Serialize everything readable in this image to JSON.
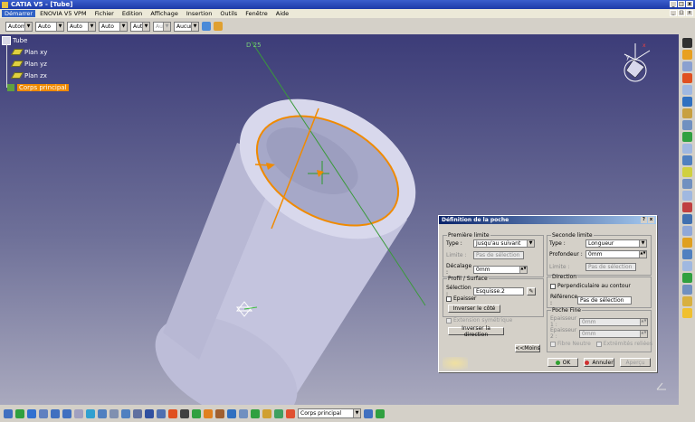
{
  "window": {
    "title": "CATIA V5 - [Tube]",
    "controls": [
      "_",
      "□",
      "x"
    ]
  },
  "menubar": {
    "items": [
      "Démarrer",
      "ENOVIA V5 VPM",
      "Fichier",
      "Edition",
      "Affichage",
      "Insertion",
      "Outils",
      "Fenêtre",
      "Aide"
    ]
  },
  "toolbar": {
    "combos": [
      "Automa",
      "Auto",
      "Auto",
      "Auto",
      "Aut",
      "Aut",
      "Aucun"
    ]
  },
  "tree": {
    "root": "Tube",
    "children": [
      "Plan xy",
      "Plan yz",
      "Plan zx",
      "Corps principal"
    ]
  },
  "viewport": {
    "axis_label": "D 25"
  },
  "dialog": {
    "title": "Définition de la poche",
    "first_limit": {
      "legend": "Première limite",
      "type_label": "Type :",
      "type_value": "Jusqu'au suivant",
      "limit_label": "Limite :",
      "limit_value": "Pas de sélection",
      "offset_label": "Décalage :",
      "offset_value": "0mm"
    },
    "profile": {
      "legend": "Profil / Surface",
      "selection_label": "Sélection :",
      "selection_value": "Esquisse.2",
      "thick_label": "Epaisser",
      "invert_side": "Inverser le côté"
    },
    "symmetric_label": "Extension symétrique",
    "invert_direction": "Inverser la direction",
    "second_limit": {
      "legend": "Seconde limite",
      "type_label": "Type :",
      "type_value": "Longueur",
      "depth_label": "Profondeur :",
      "depth_value": "0mm",
      "limit_label": "Limite :",
      "limit_value": "Pas de sélection"
    },
    "direction": {
      "legend": "Direction",
      "perp_label": "Perpendiculaire au contour",
      "ref_label": "Référence :",
      "ref_value": "Pas de sélection"
    },
    "thin": {
      "legend": "Poche Fine",
      "thick1_label": "Epaisseur 1 :",
      "thick1_value": "0mm",
      "thick2_label": "Epaisseur 2 :",
      "thick2_value": "0mm",
      "neutral_label": "Fibre Neutre",
      "merge_label": "Extrémités reliées"
    },
    "less_button": "<<Moins",
    "ok_button": "OK",
    "cancel_button": "Annuler",
    "preview_button": "Aperçu"
  },
  "status": {
    "combo_value": "Corps principal"
  },
  "colors": {
    "orange": "#f08a00",
    "titlebar": "#1c3aa8",
    "cylinder": "#c4c4de"
  }
}
